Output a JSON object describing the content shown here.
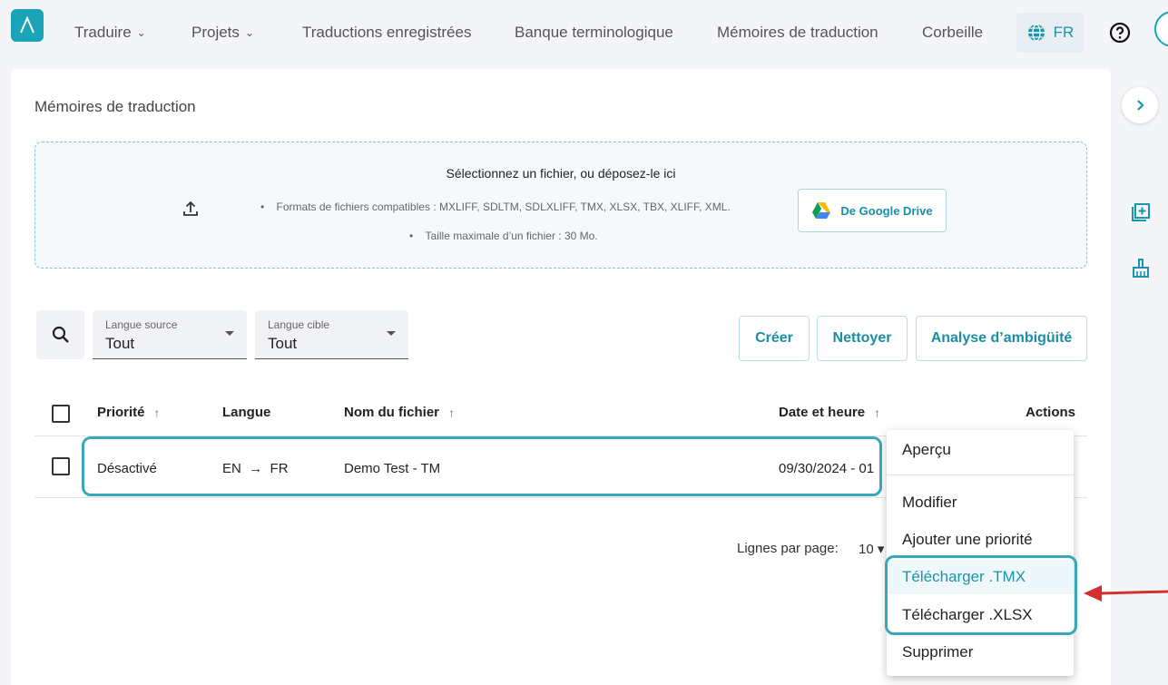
{
  "nav": {
    "items": [
      {
        "label": "Traduire",
        "dropdown": true
      },
      {
        "label": "Projets",
        "dropdown": true
      },
      {
        "label": "Traductions enregistrées"
      },
      {
        "label": "Banque terminologique"
      },
      {
        "label": "Mémoires de traduction"
      },
      {
        "label": "Corbeille"
      }
    ],
    "language": "FR"
  },
  "page": {
    "title": "Mémoires de traduction"
  },
  "upload": {
    "title": "Sélectionnez un fichier, ou déposez-le ici",
    "formats": "Formats de fichiers compatibles : MXLIFF, SDLTM, SDLXLIFF, TMX, XLSX, TBX, XLIFF, XML.",
    "max_size": "Taille maximale d’un fichier : 30 Mo.",
    "google_drive_label": "De Google Drive"
  },
  "filters": {
    "source": {
      "label": "Langue source",
      "value": "Tout"
    },
    "target": {
      "label": "Langue cible",
      "value": "Tout"
    }
  },
  "actions": {
    "create": "Créer",
    "clean": "Nettoyer",
    "ambiguity": "Analyse d’ambigüité"
  },
  "table": {
    "headers": {
      "priority": "Priorité",
      "language": "Langue",
      "filename": "Nom du fichier",
      "datetime": "Date et heure",
      "actions": "Actions"
    },
    "rows": [
      {
        "priority": "Désactivé",
        "src": "EN",
        "tgt": "FR",
        "filename": "Demo Test - TM",
        "datetime": "09/30/2024 - 01"
      }
    ]
  },
  "pager": {
    "label": "Lignes par page:",
    "value": "10"
  },
  "menu": {
    "items": [
      "Aperçu",
      "Modifier",
      "Ajouter une priorité",
      "Télécharger .TMX",
      "Télécharger .XLSX",
      "Supprimer"
    ]
  },
  "colors": {
    "accent": "#1a95ad",
    "highlight": "#3aa7b8",
    "annotation": "#d32f2f"
  }
}
